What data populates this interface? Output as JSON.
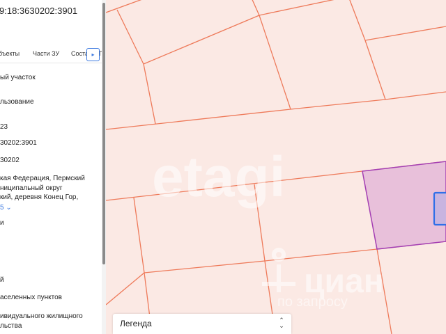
{
  "panel": {
    "title": "9:18:3630202:3901",
    "tabs": [
      "бъекты",
      "Части ЗУ",
      "Соста",
      "Г"
    ],
    "fields": {
      "type": "ый участок",
      "usage": "льзование",
      "year": "23",
      "cadastral_number": "30202:3901",
      "quarter": "30202",
      "address_lines": [
        "кая Федерация, Пермский",
        "ниципальный округ",
        "кий, деревня Конец Гор,"
      ],
      "show_more": "5",
      "field_j": "и",
      "field_ii": "й",
      "category": "аселенных пунктов",
      "permitted_use": [
        "ивидуального жилищного",
        "льства"
      ]
    }
  },
  "map": {
    "watermarks": [
      "etagi",
      "циан",
      "по запросу"
    ]
  },
  "legend": {
    "label": "Легенда"
  },
  "colors": {
    "map_background": "#fbe9e4",
    "parcel_border": "#ee7a5a",
    "selected_fill": "#e8c0da",
    "selected_border": "#a43fb3",
    "building_border": "#2f6fe8",
    "accent": "#3a78e0"
  },
  "icons": {
    "tab_scroll": "chevron-right-icon",
    "show_more": "chevron-down-icon",
    "legend_toggle": "up-down-chevron-icon"
  }
}
